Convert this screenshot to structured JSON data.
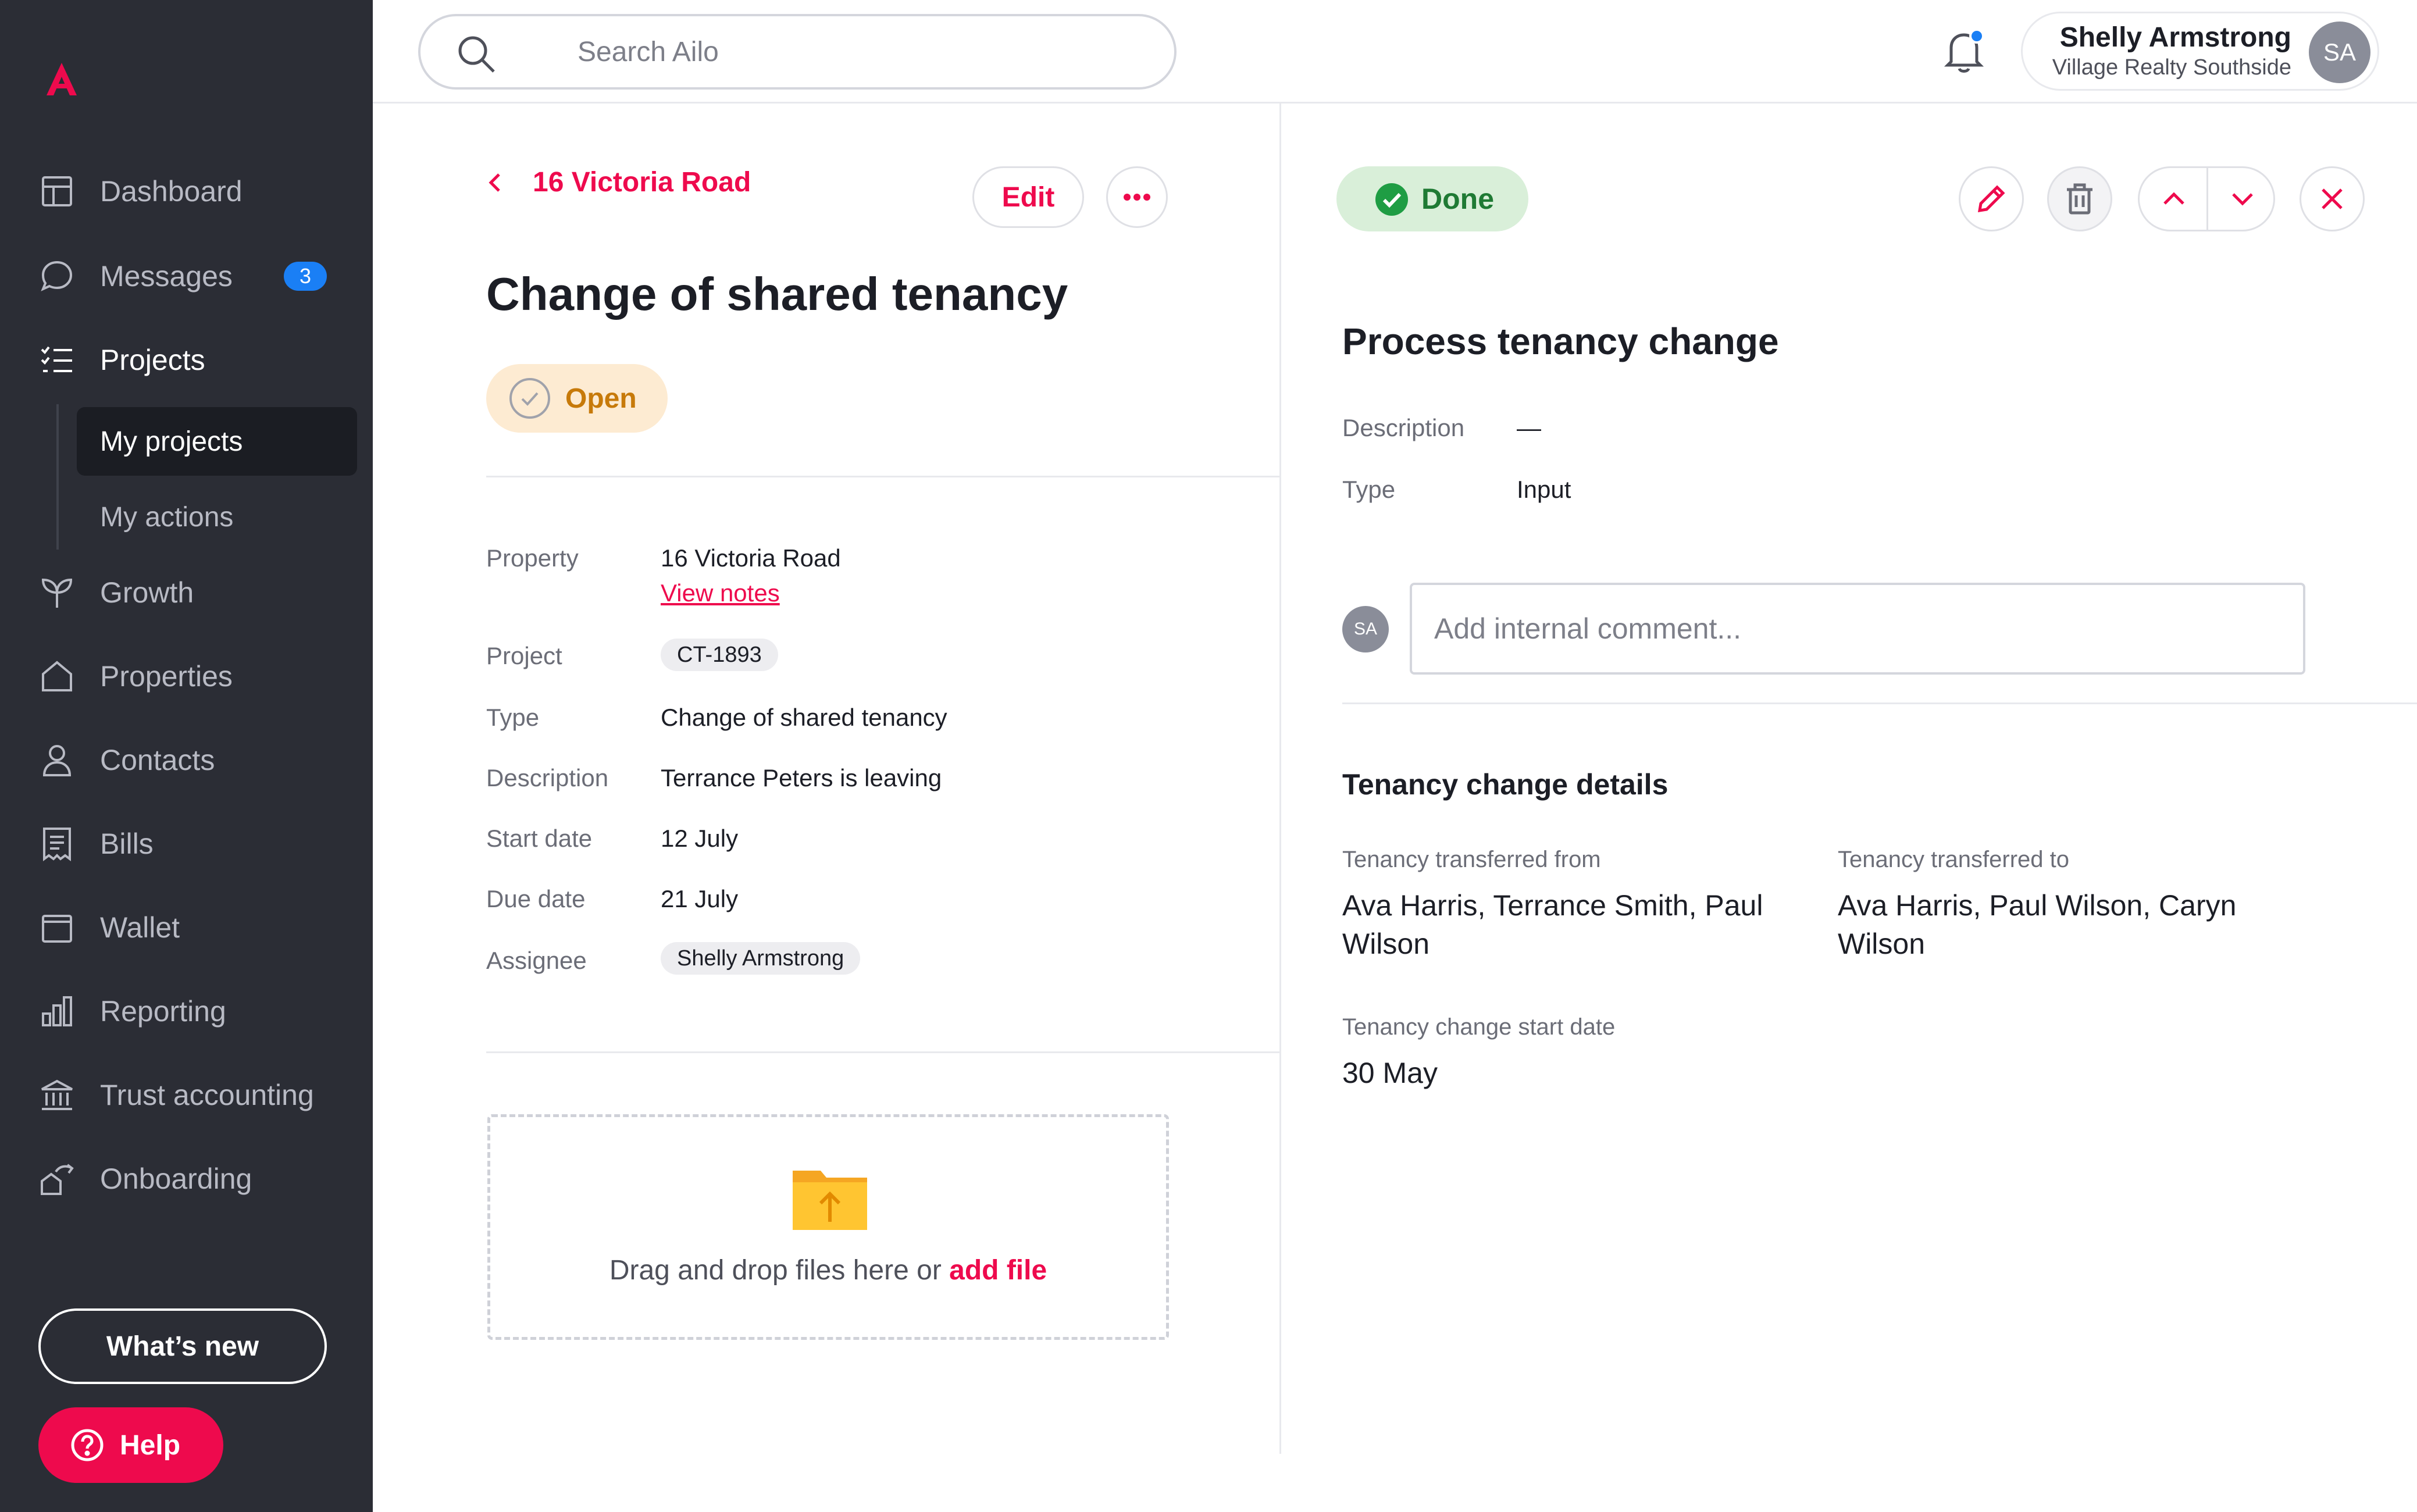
{
  "sidebar": {
    "nav": [
      {
        "label": "Dashboard",
        "icon": "dashboard-icon"
      },
      {
        "label": "Messages",
        "icon": "chat-bubble-icon",
        "badge": "3"
      },
      {
        "label": "Projects",
        "icon": "checklist-icon"
      },
      {
        "label": "Growth",
        "icon": "sprout-icon"
      },
      {
        "label": "Properties",
        "icon": "house-icon"
      },
      {
        "label": "Contacts",
        "icon": "person-icon"
      },
      {
        "label": "Bills",
        "icon": "receipt-icon"
      },
      {
        "label": "Wallet",
        "icon": "wallet-icon"
      },
      {
        "label": "Reporting",
        "icon": "bar-chart-icon"
      },
      {
        "label": "Trust accounting",
        "icon": "bank-icon"
      },
      {
        "label": "Onboarding",
        "icon": "onboarding-icon"
      }
    ],
    "subnav": [
      {
        "label": "My projects"
      },
      {
        "label": "My actions"
      }
    ],
    "whats_new": "What’s new",
    "help": "Help"
  },
  "topbar": {
    "search_placeholder": "Search Ailo",
    "user": {
      "name": "Shelly Armstrong",
      "org": "Village Realty Southside",
      "initials": "SA"
    }
  },
  "project": {
    "back_label": "16 Victoria Road",
    "edit_label": "Edit",
    "title": "Change of shared tenancy",
    "status": "Open",
    "fields": {
      "property_label": "Property",
      "property_value": "16 Victoria Road",
      "view_notes": "View notes",
      "project_label": "Project",
      "project_value": "CT-1893",
      "type_label": "Type",
      "type_value": "Change of shared tenancy",
      "description_label": "Description",
      "description_value": "Terrance Peters is leaving",
      "start_label": "Start date",
      "start_value": "12 July",
      "due_label": "Due date",
      "due_value": "21 July",
      "assignee_label": "Assignee",
      "assignee_value": "Shelly Armstrong"
    },
    "dropzone": {
      "text": "Drag and drop files here or",
      "link": "add file"
    }
  },
  "task": {
    "status": "Done",
    "title": "Process tenancy change",
    "description_label": "Description",
    "description_value": "—",
    "type_label": "Type",
    "type_value": "Input",
    "comment_avatar": "SA",
    "comment_placeholder": "Add internal comment...",
    "details_title": "Tenancy change details",
    "from_label": "Tenancy transferred from",
    "from_value": "Ava Harris, Terrance Smith, Paul Wilson",
    "to_label": "Tenancy transferred to",
    "to_value": "Ava Harris, Paul Wilson, Caryn Wilson",
    "start_label": "Tenancy change start date",
    "start_value": "30 May"
  },
  "colors": {
    "brand": "#ee0a4d",
    "sidebar_bg": "#2b2d35",
    "open_bg": "#fdebd2",
    "open_text": "#c77a0a",
    "done_bg": "#d9efd9",
    "done_text": "#1f7a34",
    "badge": "#1a7ff5"
  }
}
